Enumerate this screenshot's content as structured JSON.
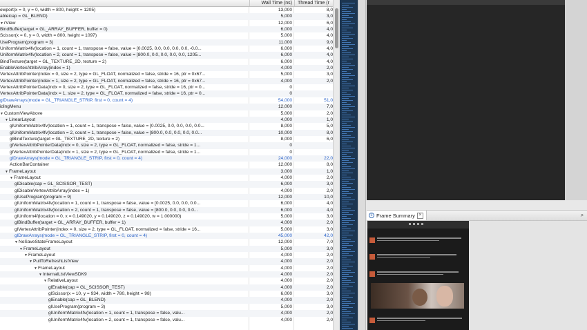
{
  "header": {
    "name_col": "",
    "wall_col": "Wall Time (ns)",
    "thread_col": "Thread Time (r"
  },
  "rows": [
    {
      "indent": 0,
      "tri": false,
      "label": "ewport(x = 0, y = 0, width = 800, height = 1205)",
      "wall": "13,000",
      "thread": "8,0",
      "blue": false
    },
    {
      "indent": 0,
      "tri": false,
      "label": "ableicap = GL_BLEND)",
      "wall": "5,000",
      "thread": "3,0",
      "blue": false
    },
    {
      "indent": 0,
      "tri": true,
      "label": "rView",
      "wall": "12,000",
      "thread": "6,0",
      "blue": false
    },
    {
      "indent": 0,
      "tri": false,
      "label": "BindBuffer(target = GL_ARRAY_BUFFER, buffer = 0)",
      "wall": "6,000",
      "thread": "4,0",
      "blue": false
    },
    {
      "indent": 0,
      "tri": false,
      "label": "Scissor(x = 0, y = 0, width = 800, height = 1097)",
      "wall": "5,000",
      "thread": "4,0",
      "blue": false
    },
    {
      "indent": 0,
      "tri": false,
      "label": "UseProgram(program = 3)",
      "wall": "11,000",
      "thread": "9,0",
      "blue": false
    },
    {
      "indent": 0,
      "tri": false,
      "label": "UniformMatrix4fv(location = 1, count = 1, transpose = false, value = [0.0025, 0.0, 0.0, 0.0, 0.0, -0.0...",
      "wall": "6,000",
      "thread": "4,0",
      "blue": false
    },
    {
      "indent": 0,
      "tri": false,
      "label": "UniformMatrix4fv(location = 2, count = 1, transpose = false, value = [800.0, 0.0, 0.0, 0.0, 0.0, 1205...",
      "wall": "6,000",
      "thread": "4,0",
      "blue": false
    },
    {
      "indent": 0,
      "tri": false,
      "label": "BindTexture(target = GL_TEXTURE_2D, texture = 2)",
      "wall": "6,000",
      "thread": "4,0",
      "blue": false
    },
    {
      "indent": 0,
      "tri": false,
      "label": "EnableVertexAttribArray(index = 1)",
      "wall": "4,000",
      "thread": "2,0",
      "blue": false
    },
    {
      "indent": 0,
      "tri": false,
      "label": "VertexAttribPointer(index = 0, size = 2, type = GL_FLOAT, normalized = false, stride = 16, ptr = 0x67...",
      "wall": "5,000",
      "thread": "3,0",
      "blue": false
    },
    {
      "indent": 0,
      "tri": false,
      "label": "VertexAttribPointer(index = 1, size = 2, type = GL_FLOAT, normalized = false, stride = 16, ptr = 0x67...",
      "wall": "4,000",
      "thread": "2,0",
      "blue": false
    },
    {
      "indent": 0,
      "tri": false,
      "label": "VertexAttribPointerData(indx = 0, size = 2, type = GL_FLOAT, normalized = false, stride = 16, ptr = 0...",
      "wall": "0",
      "thread": "",
      "blue": false
    },
    {
      "indent": 0,
      "tri": false,
      "label": "VertexAttribPointerData(indx = 1, size = 2, type = GL_FLOAT, normalized = false, stride = 16, ptr = 0...",
      "wall": "0",
      "thread": "",
      "blue": false
    },
    {
      "indent": 0,
      "tri": false,
      "label": "glDrawArrays(mode = GL_TRIANGLE_STRIP, first = 0, count = 4)",
      "wall": "54,000",
      "thread": "51,0",
      "blue": true
    },
    {
      "indent": 0,
      "tri": false,
      "label": "idingMenu",
      "wall": "12,000",
      "thread": "7,0",
      "blue": false
    },
    {
      "indent": 0,
      "tri": true,
      "label": "CustomViewAbove",
      "wall": "5,000",
      "thread": "2,0",
      "blue": false
    },
    {
      "indent": 1,
      "tri": true,
      "label": "LinearLayout",
      "wall": "4,000",
      "thread": "1,0",
      "blue": false
    },
    {
      "indent": 2,
      "tri": false,
      "label": "glUniformMatrix4fv(location = 1, count = 1, transpose = false, value = [0.0025, 0.0, 0.0, 0.0, 0.0...",
      "wall": "8,000",
      "thread": "5,0",
      "blue": false
    },
    {
      "indent": 2,
      "tri": false,
      "label": "glUniformMatrix4fv(location = 2, count = 1, transpose = false, value = [800.0, 0.0, 0.0, 0.0, 0.0...",
      "wall": "10,000",
      "thread": "8,0",
      "blue": false
    },
    {
      "indent": 2,
      "tri": false,
      "label": "glBindTexture(target = GL_TEXTURE_2D, texture = 2)",
      "wall": "8,000",
      "thread": "6,0",
      "blue": false
    },
    {
      "indent": 2,
      "tri": false,
      "label": "glVertexAttribPointerData(indx = 0, size = 2, type = GL_FLOAT, normalized = false, stride = 1...",
      "wall": "0",
      "thread": "",
      "blue": false
    },
    {
      "indent": 2,
      "tri": false,
      "label": "glVertexAttribPointerData(indx = 1, size = 2, type = GL_FLOAT, normalized = false, stride = 1...",
      "wall": "0",
      "thread": "",
      "blue": false
    },
    {
      "indent": 2,
      "tri": false,
      "label": "glDrawArrays(mode = GL_TRIANGLE_STRIP, first = 0, count = 4)",
      "wall": "24,000",
      "thread": "22,0",
      "blue": true
    },
    {
      "indent": 2,
      "tri": false,
      "label": "ActionBarContainer",
      "wall": "12,000",
      "thread": "8,0",
      "blue": false
    },
    {
      "indent": 1,
      "tri": true,
      "label": "FrameLayout",
      "wall": "3,000",
      "thread": "1,0",
      "blue": false
    },
    {
      "indent": 2,
      "tri": true,
      "label": "FrameLayout",
      "wall": "4,000",
      "thread": "2,0",
      "blue": false
    },
    {
      "indent": 3,
      "tri": false,
      "label": "glDisable(cap = GL_SCISSOR_TEST)",
      "wall": "6,000",
      "thread": "3,0",
      "blue": false
    },
    {
      "indent": 3,
      "tri": false,
      "label": "glDisableVertexAttribArray(index = 1)",
      "wall": "4,000",
      "thread": "2,0",
      "blue": false
    },
    {
      "indent": 3,
      "tri": false,
      "label": "glUseProgram(program = 9)",
      "wall": "12,000",
      "thread": "10,0",
      "blue": false
    },
    {
      "indent": 3,
      "tri": false,
      "label": "glUniformMatrix4fv(location = 1, count = 1, transpose = false, value = [0.0025, 0.0, 0.0, 0.0...",
      "wall": "6,000",
      "thread": "4,0",
      "blue": false
    },
    {
      "indent": 3,
      "tri": false,
      "label": "glUniformMatrix4fv(location = 2, count = 1, transpose = false, value = [800.0, 0.0, 0.0, 0.0...",
      "wall": "6,000",
      "thread": "4,0",
      "blue": false
    },
    {
      "indent": 3,
      "tri": false,
      "label": "glUniform4f(location = 0, x = 0.149020, y = 0.149020, z = 0.149020, w = 1.000000)",
      "wall": "5,000",
      "thread": "3,0",
      "blue": false
    },
    {
      "indent": 3,
      "tri": false,
      "label": "glBindBuffer(target = GL_ARRAY_BUFFER, buffer = 1)",
      "wall": "4,000",
      "thread": "2,0",
      "blue": false
    },
    {
      "indent": 3,
      "tri": false,
      "label": "glVertexAttribPointer(index = 0, size = 2, type = GL_FLOAT, normalized = false, stride = 16...",
      "wall": "5,000",
      "thread": "3,0",
      "blue": false
    },
    {
      "indent": 3,
      "tri": false,
      "label": "glDrawArrays(mode = GL_TRIANGLE_STRIP, first = 0, count = 4)",
      "wall": "45,000",
      "thread": "42,0",
      "blue": true
    },
    {
      "indent": 3,
      "tri": true,
      "label": "NoSaveStateFrameLayout",
      "wall": "12,000",
      "thread": "7,0",
      "blue": false
    },
    {
      "indent": 4,
      "tri": true,
      "label": "FrameLayout",
      "wall": "5,000",
      "thread": "3,0",
      "blue": false
    },
    {
      "indent": 5,
      "tri": true,
      "label": "FrameLayout",
      "wall": "4,000",
      "thread": "2,0",
      "blue": false
    },
    {
      "indent": 6,
      "tri": true,
      "label": "PullToRefreshListView",
      "wall": "4,000",
      "thread": "2,0",
      "blue": false
    },
    {
      "indent": 7,
      "tri": true,
      "label": "FrameLayout",
      "wall": "4,000",
      "thread": "2,0",
      "blue": false
    },
    {
      "indent": 8,
      "tri": true,
      "label": "InternalListViewSDK9",
      "wall": "4,000",
      "thread": "2,0",
      "blue": false
    },
    {
      "indent": 9,
      "tri": true,
      "label": "RelativeLayout",
      "wall": "4,000",
      "thread": "2,0",
      "blue": false
    },
    {
      "indent": 10,
      "tri": false,
      "label": "glEnable(cap = GL_SCISSOR_TEST)",
      "wall": "4,000",
      "thread": "2,0",
      "blue": false
    },
    {
      "indent": 10,
      "tri": false,
      "label": "glScissor(x = 10, y = 934, width = 780, height = 98)",
      "wall": "6,000",
      "thread": "3,0",
      "blue": false
    },
    {
      "indent": 10,
      "tri": false,
      "label": "glEnable(cap = GL_BLEND)",
      "wall": "4,000",
      "thread": "2,0",
      "blue": false
    },
    {
      "indent": 10,
      "tri": false,
      "label": "glUseProgram(program = 3)",
      "wall": "5,000",
      "thread": "3,0",
      "blue": false
    },
    {
      "indent": 10,
      "tri": false,
      "label": "glUniformMatrix4fv(location = 1, count = 1, transpose = false, valu...",
      "wall": "4,000",
      "thread": "2,0",
      "blue": false
    },
    {
      "indent": 10,
      "tri": false,
      "label": "glUniformMatrix4fv(location = 2, count = 1, transpose = false, valu...",
      "wall": "4,000",
      "thread": "2,0",
      "blue": false
    }
  ],
  "frame_summary": {
    "tab_label": "Frame Summary",
    "tab_icon": "frame-summary-icon",
    "close_icon": "close-icon",
    "zoom_icon": "zoom-icon"
  },
  "colors": {
    "call_blue": "#2b63c9",
    "minimap_bg": "#1c3550",
    "preview_dark": "#262626"
  }
}
